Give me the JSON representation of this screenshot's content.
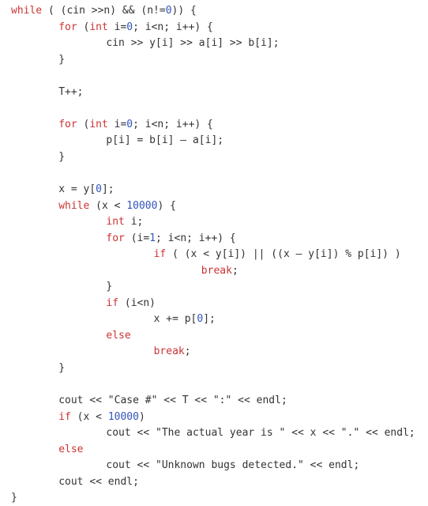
{
  "document": {
    "kind": "source-code-listing",
    "language": "C++",
    "background_color": "#ffffff",
    "theme": {
      "keyword_color": "#cc3333",
      "number_color": "#3355bb",
      "text_color": "#333333"
    },
    "indent_unit_spaces": 8,
    "total_lines": 31
  },
  "code": {
    "lines": [
      {
        "n": 1,
        "indent": 0,
        "tokens": [
          {
            "t": "kw",
            "v": "while"
          },
          {
            "t": "txt",
            "v": " ( (cin >>n) && (n!="
          },
          {
            "t": "num",
            "v": "0"
          },
          {
            "t": "txt",
            "v": ")) {"
          }
        ]
      },
      {
        "n": 2,
        "indent": 1,
        "tokens": [
          {
            "t": "kw",
            "v": "for"
          },
          {
            "t": "txt",
            "v": " ("
          },
          {
            "t": "kw",
            "v": "int"
          },
          {
            "t": "txt",
            "v": " i="
          },
          {
            "t": "num",
            "v": "0"
          },
          {
            "t": "txt",
            "v": "; i<n; i++) {"
          }
        ]
      },
      {
        "n": 3,
        "indent": 2,
        "tokens": [
          {
            "t": "txt",
            "v": "cin >> y[i] >> a[i] >> b[i];"
          }
        ]
      },
      {
        "n": 4,
        "indent": 1,
        "tokens": [
          {
            "t": "txt",
            "v": "}"
          }
        ]
      },
      {
        "n": 5,
        "indent": 0,
        "tokens": []
      },
      {
        "n": 6,
        "indent": 1,
        "tokens": [
          {
            "t": "txt",
            "v": "T++;"
          }
        ]
      },
      {
        "n": 7,
        "indent": 0,
        "tokens": []
      },
      {
        "n": 8,
        "indent": 1,
        "tokens": [
          {
            "t": "kw",
            "v": "for"
          },
          {
            "t": "txt",
            "v": " ("
          },
          {
            "t": "kw",
            "v": "int"
          },
          {
            "t": "txt",
            "v": " i="
          },
          {
            "t": "num",
            "v": "0"
          },
          {
            "t": "txt",
            "v": "; i<n; i++) {"
          }
        ]
      },
      {
        "n": 9,
        "indent": 2,
        "tokens": [
          {
            "t": "txt",
            "v": "p[i] = b[i] – a[i];"
          }
        ]
      },
      {
        "n": 10,
        "indent": 1,
        "tokens": [
          {
            "t": "txt",
            "v": "}"
          }
        ]
      },
      {
        "n": 11,
        "indent": 0,
        "tokens": []
      },
      {
        "n": 12,
        "indent": 1,
        "tokens": [
          {
            "t": "txt",
            "v": "x = y["
          },
          {
            "t": "num",
            "v": "0"
          },
          {
            "t": "txt",
            "v": "];"
          }
        ]
      },
      {
        "n": 13,
        "indent": 1,
        "tokens": [
          {
            "t": "kw",
            "v": "while"
          },
          {
            "t": "txt",
            "v": " (x < "
          },
          {
            "t": "num",
            "v": "10000"
          },
          {
            "t": "txt",
            "v": ") {"
          }
        ]
      },
      {
        "n": 14,
        "indent": 2,
        "tokens": [
          {
            "t": "kw",
            "v": "int"
          },
          {
            "t": "txt",
            "v": " i;"
          }
        ]
      },
      {
        "n": 15,
        "indent": 2,
        "tokens": [
          {
            "t": "kw",
            "v": "for"
          },
          {
            "t": "txt",
            "v": " (i="
          },
          {
            "t": "num",
            "v": "1"
          },
          {
            "t": "txt",
            "v": "; i<n; i++) {"
          }
        ]
      },
      {
        "n": 16,
        "indent": 3,
        "tokens": [
          {
            "t": "kw",
            "v": "if"
          },
          {
            "t": "txt",
            "v": " ( (x < y[i]) || ((x – y[i]) % p[i]) )"
          }
        ]
      },
      {
        "n": 17,
        "indent": 4,
        "tokens": [
          {
            "t": "kw",
            "v": "break"
          },
          {
            "t": "txt",
            "v": ";"
          }
        ]
      },
      {
        "n": 18,
        "indent": 2,
        "tokens": [
          {
            "t": "txt",
            "v": "}"
          }
        ]
      },
      {
        "n": 19,
        "indent": 2,
        "tokens": [
          {
            "t": "kw",
            "v": "if"
          },
          {
            "t": "txt",
            "v": " (i<n)"
          }
        ]
      },
      {
        "n": 20,
        "indent": 3,
        "tokens": [
          {
            "t": "txt",
            "v": "x += p["
          },
          {
            "t": "num",
            "v": "0"
          },
          {
            "t": "txt",
            "v": "];"
          }
        ]
      },
      {
        "n": 21,
        "indent": 2,
        "tokens": [
          {
            "t": "kw",
            "v": "else"
          }
        ]
      },
      {
        "n": 22,
        "indent": 3,
        "tokens": [
          {
            "t": "kw",
            "v": "break"
          },
          {
            "t": "txt",
            "v": ";"
          }
        ]
      },
      {
        "n": 23,
        "indent": 1,
        "tokens": [
          {
            "t": "txt",
            "v": "}"
          }
        ]
      },
      {
        "n": 24,
        "indent": 0,
        "tokens": []
      },
      {
        "n": 25,
        "indent": 1,
        "tokens": [
          {
            "t": "txt",
            "v": "cout << \"Case #\" << T << \":\" << endl;"
          }
        ]
      },
      {
        "n": 26,
        "indent": 1,
        "tokens": [
          {
            "t": "kw",
            "v": "if"
          },
          {
            "t": "txt",
            "v": " (x < "
          },
          {
            "t": "num",
            "v": "10000"
          },
          {
            "t": "txt",
            "v": ")"
          }
        ]
      },
      {
        "n": 27,
        "indent": 2,
        "tokens": [
          {
            "t": "txt",
            "v": "cout << \"The actual year is \" << x << \".\" << endl;"
          }
        ]
      },
      {
        "n": 28,
        "indent": 1,
        "tokens": [
          {
            "t": "kw",
            "v": "else"
          }
        ]
      },
      {
        "n": 29,
        "indent": 2,
        "tokens": [
          {
            "t": "txt",
            "v": "cout << \"Unknown bugs detected.\" << endl;"
          }
        ]
      },
      {
        "n": 30,
        "indent": 1,
        "tokens": [
          {
            "t": "txt",
            "v": "cout << endl;"
          }
        ]
      },
      {
        "n": 31,
        "indent": 0,
        "tokens": [
          {
            "t": "txt",
            "v": "}"
          }
        ]
      }
    ]
  }
}
